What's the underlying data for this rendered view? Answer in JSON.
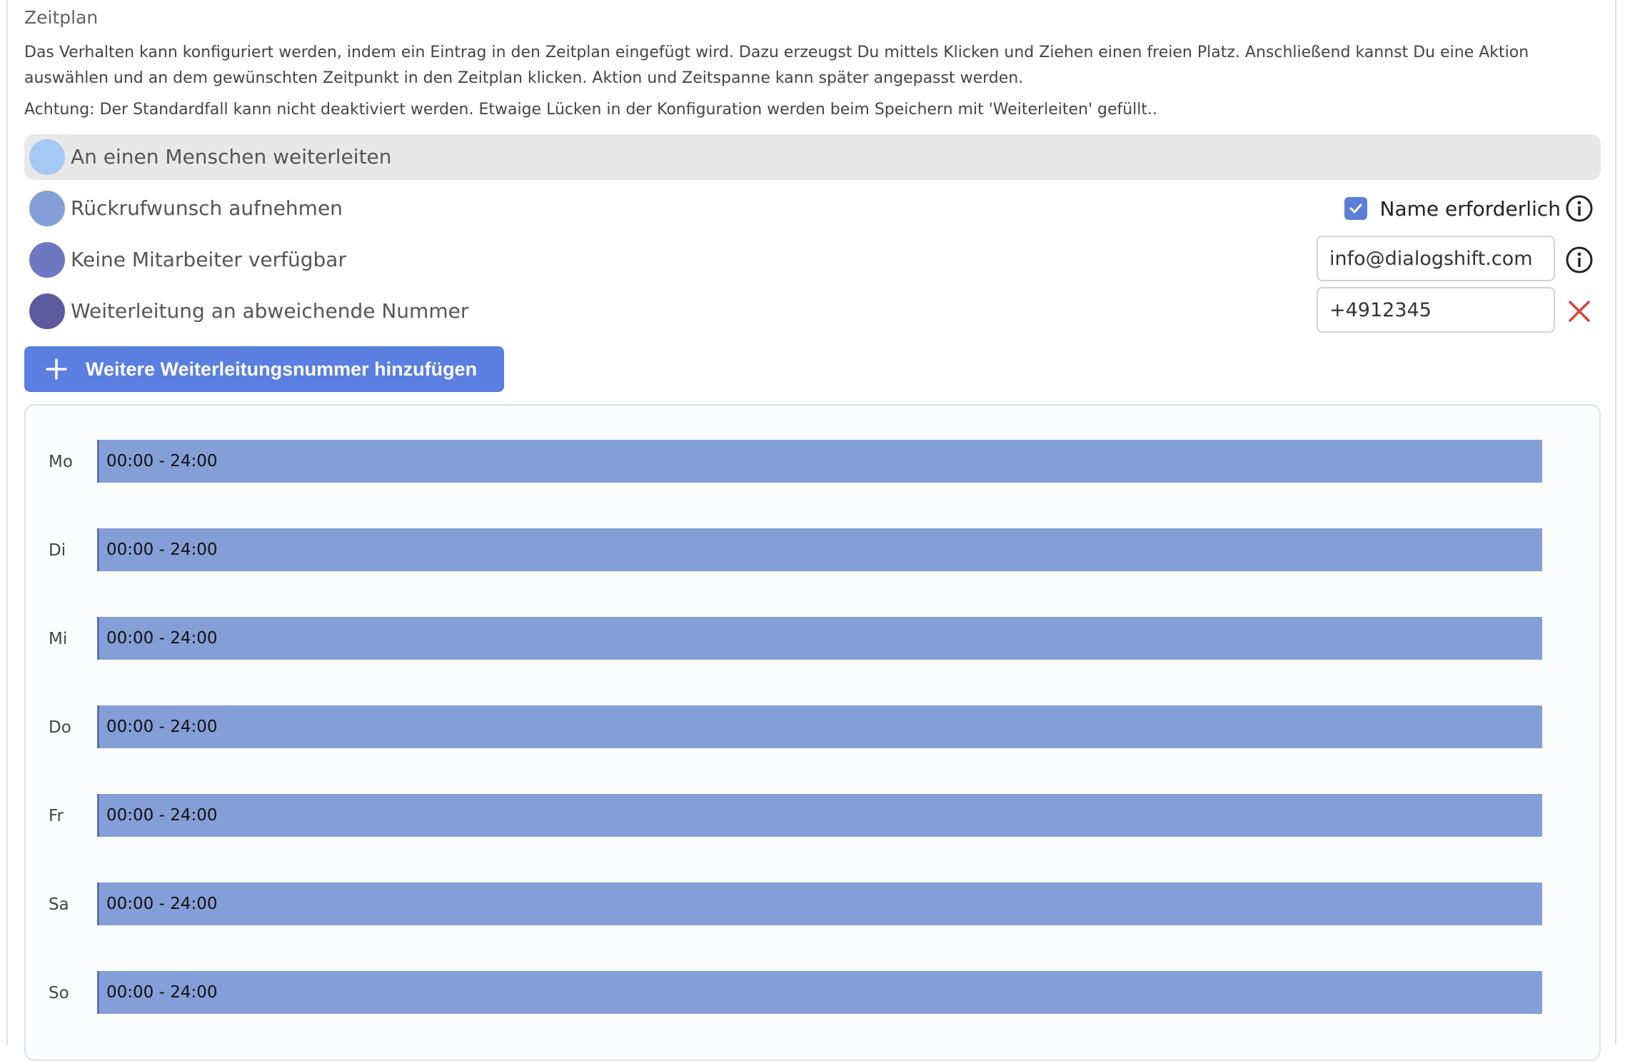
{
  "section": {
    "title": "Zeitplan",
    "description": "Das Verhalten kann konfiguriert werden, indem ein Eintrag in den Zeitplan eingefügt wird. Dazu erzeugst Du mittels Klicken und Ziehen einen freien Platz. Anschließend kannst Du eine Aktion auswählen und an dem gewünschten Zeitpunkt in den Zeitplan klicken. Aktion und Zeitspanne kann später angepasst werden.",
    "warning": "Achtung: Der Standardfall kann nicht deaktiviert werden. Etwaige Lücken in der Konfiguration werden beim Speichern mit 'Weiterleiten' gefüllt.."
  },
  "actions": [
    {
      "label": "An einen Menschen weiterleiten",
      "color": "#a6c8f4"
    },
    {
      "label": "Rückrufwunsch aufnehmen",
      "color": "#849fd7",
      "checkbox_label": "Name erforderlich",
      "checked": true
    },
    {
      "label": "Keine Mitarbeiter verfügbar",
      "color": "#6e78c2",
      "field_value": "info@dialogshift.com"
    },
    {
      "label": "Weiterleitung an abweichende Nummer",
      "color": "#5e5a9e",
      "field_value": "+4912345"
    }
  ],
  "add_button": {
    "label": "Weitere Weiterleitungsnummer hinzufügen"
  },
  "schedule": {
    "bar_color": "#849fd7",
    "days": [
      {
        "day": "Mo",
        "range": "00:00 - 24:00"
      },
      {
        "day": "Di",
        "range": "00:00 - 24:00"
      },
      {
        "day": "Mi",
        "range": "00:00 - 24:00"
      },
      {
        "day": "Do",
        "range": "00:00 - 24:00"
      },
      {
        "day": "Fr",
        "range": "00:00 - 24:00"
      },
      {
        "day": "Sa",
        "range": "00:00 - 24:00"
      },
      {
        "day": "So",
        "range": "00:00 - 24:00"
      }
    ]
  }
}
